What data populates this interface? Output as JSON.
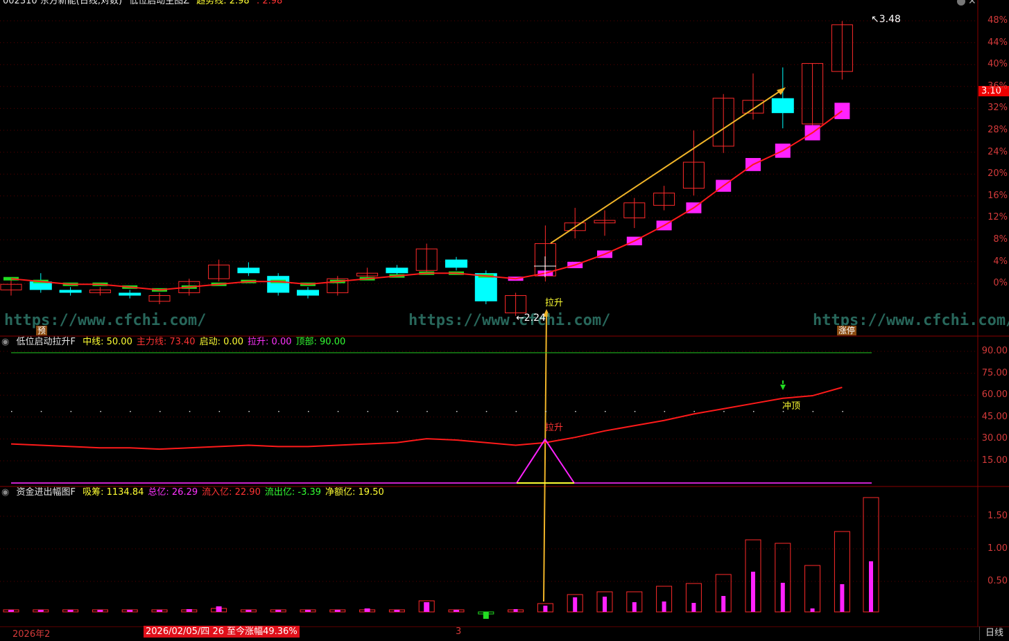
{
  "top_header": {
    "stock": "002310 东方新能(日线,对数)",
    "indicator": "低位启动主图Z",
    "trend_label": "趋势线: 2.98",
    "trend_value2": ": 2.98"
  },
  "panel1_header": {
    "name": "低位启动拉升F",
    "items": [
      {
        "text": "中线: 50.00",
        "color": "#ffff33"
      },
      {
        "text": "主力线: 73.40",
        "color": "#ff3333"
      },
      {
        "text": "启动: 0.00",
        "color": "#ffff33"
      },
      {
        "text": "拉升: 0.00",
        "color": "#ff33ff"
      },
      {
        "text": "顶部: 90.00",
        "color": "#33ff33"
      }
    ]
  },
  "panel2_header": {
    "name": "资金进出幅图F",
    "items": [
      {
        "text": "吸筹: 1134.84",
        "color": "#ffff33"
      },
      {
        "text": "总亿: 26.29",
        "color": "#ff33ff"
      },
      {
        "text": "流入亿: 22.90",
        "color": "#ff3333"
      },
      {
        "text": "流出亿: -3.39",
        "color": "#33ff33"
      },
      {
        "text": "净额亿: 19.50",
        "color": "#ffff33"
      }
    ]
  },
  "watermark": "https://www.cfchi.com/",
  "annotations": {
    "high_label": "3.48",
    "low_label": "2.24",
    "pull_up_main": "拉升",
    "pull_up_sub": "拉升",
    "top_touch": "冲顶",
    "pre": "预",
    "limit_up": "涨停"
  },
  "price_axis": [
    "48%",
    "44%",
    "40%",
    "36%",
    "32%",
    "28%",
    "24%",
    "20%",
    "16%",
    "12%",
    "8%",
    "4%",
    "0%"
  ],
  "price_tag": "3.10",
  "sub1_axis": [
    "90.00",
    "75.00",
    "60.00",
    "45.00",
    "30.00",
    "15.00"
  ],
  "sub2_axis": [
    "1.50",
    "1.00",
    "0.50"
  ],
  "bottom": {
    "year_label": "2026年2",
    "date_highlight": "2026/02/05/四 26 至今涨幅49.36%",
    "month_label": "3",
    "period_button": "日线"
  },
  "colors": {
    "up": "#ff2a2a",
    "down_cyan": "#00ffff",
    "magenta": "#ff22ff",
    "trend_red": "#ff1a1a",
    "arrow_gold": "#f0b428",
    "green": "#22dd22"
  },
  "chart_data": {
    "type": "candlestick",
    "candles": [
      {
        "open": 2.3,
        "close": 2.32,
        "high": 2.34,
        "low": 2.28,
        "up": true
      },
      {
        "open": 2.33,
        "close": 2.3,
        "high": 2.36,
        "low": 2.29,
        "up": false
      },
      {
        "open": 2.3,
        "close": 2.29,
        "high": 2.31,
        "low": 2.28,
        "up": false
      },
      {
        "open": 2.29,
        "close": 2.3,
        "high": 2.31,
        "low": 2.28,
        "up": true
      },
      {
        "open": 2.29,
        "close": 2.28,
        "high": 2.3,
        "low": 2.27,
        "up": false
      },
      {
        "open": 2.26,
        "close": 2.28,
        "high": 2.29,
        "low": 2.25,
        "up": true
      },
      {
        "open": 2.29,
        "close": 2.33,
        "high": 2.34,
        "low": 2.28,
        "up": true
      },
      {
        "open": 2.34,
        "close": 2.39,
        "high": 2.41,
        "low": 2.33,
        "up": true
      },
      {
        "open": 2.38,
        "close": 2.36,
        "high": 2.4,
        "low": 2.35,
        "up": false
      },
      {
        "open": 2.35,
        "close": 2.29,
        "high": 2.36,
        "low": 2.28,
        "up": false
      },
      {
        "open": 2.3,
        "close": 2.28,
        "high": 2.31,
        "low": 2.27,
        "up": false
      },
      {
        "open": 2.29,
        "close": 2.34,
        "high": 2.35,
        "low": 2.28,
        "up": true
      },
      {
        "open": 2.35,
        "close": 2.36,
        "high": 2.38,
        "low": 2.34,
        "up": true
      },
      {
        "open": 2.38,
        "close": 2.36,
        "high": 2.39,
        "low": 2.35,
        "up": false
      },
      {
        "open": 2.37,
        "close": 2.45,
        "high": 2.47,
        "low": 2.36,
        "up": true
      },
      {
        "open": 2.41,
        "close": 2.38,
        "high": 2.42,
        "low": 2.37,
        "up": false
      },
      {
        "open": 2.36,
        "close": 2.26,
        "high": 2.37,
        "low": 2.25,
        "up": false
      },
      {
        "open": 2.22,
        "close": 2.28,
        "high": 2.29,
        "low": 2.21,
        "up": true
      },
      {
        "open": 2.35,
        "close": 2.47,
        "high": 2.54,
        "low": 2.33,
        "up": true
      },
      {
        "open": 2.52,
        "close": 2.55,
        "high": 2.61,
        "low": 2.49,
        "up": true
      },
      {
        "open": 2.55,
        "close": 2.56,
        "high": 2.6,
        "low": 2.5,
        "up": true
      },
      {
        "open": 2.57,
        "close": 2.63,
        "high": 2.65,
        "low": 2.53,
        "up": true
      },
      {
        "open": 2.62,
        "close": 2.67,
        "high": 2.7,
        "low": 2.6,
        "up": true
      },
      {
        "open": 2.69,
        "close": 2.8,
        "high": 2.94,
        "low": 2.66,
        "up": true
      },
      {
        "open": 2.87,
        "close": 3.09,
        "high": 3.11,
        "low": 2.84,
        "up": true
      },
      {
        "open": 3.02,
        "close": 3.08,
        "high": 3.21,
        "low": 2.99,
        "up": true
      },
      {
        "open": 3.09,
        "close": 3.02,
        "high": 3.24,
        "low": 2.95,
        "up": false
      },
      {
        "open": 2.97,
        "close": 3.26,
        "high": 3.26,
        "low": 2.96,
        "up": true
      },
      {
        "open": 3.22,
        "close": 3.46,
        "high": 3.48,
        "low": 3.18,
        "up": true
      }
    ],
    "trend_line": [
      2.34,
      2.33,
      2.32,
      2.32,
      2.31,
      2.3,
      2.31,
      2.32,
      2.33,
      2.33,
      2.32,
      2.33,
      2.34,
      2.35,
      2.36,
      2.36,
      2.35,
      2.34,
      2.36,
      2.39,
      2.43,
      2.48,
      2.54,
      2.61,
      2.7,
      2.79,
      2.85,
      2.93,
      3.03
    ],
    "main_force_line": [
      30,
      29,
      28,
      27,
      27,
      26,
      27,
      28,
      29,
      28,
      28,
      29,
      30,
      31,
      34,
      33,
      31,
      29,
      31,
      35,
      40,
      44,
      48,
      53,
      57,
      61,
      65,
      67,
      73.4
    ],
    "fund_total": [
      0.02,
      0.02,
      0.02,
      0.02,
      0.03,
      0.03,
      0.02,
      0.05,
      0.02,
      0.03,
      0.03,
      0.02,
      0.03,
      0.02,
      0.16,
      0.02,
      -0.03,
      0.02,
      0.12,
      0.25,
      0.29,
      0.29,
      0.37,
      0.41,
      0.54,
      1.04,
      0.99,
      0.67,
      1.16,
      1.65
    ],
    "fund_inflow": [
      0.01,
      0.01,
      0.01,
      0.01,
      0.02,
      0.02,
      0.04,
      0.08,
      0.03,
      0.02,
      0.02,
      0.03,
      0.05,
      0.03,
      0.14,
      0.02,
      -0.1,
      0.04,
      0.09,
      0.21,
      0.22,
      0.14,
      0.15,
      0.13,
      0.23,
      0.58,
      0.42,
      0.05,
      0.4,
      0.73
    ]
  }
}
